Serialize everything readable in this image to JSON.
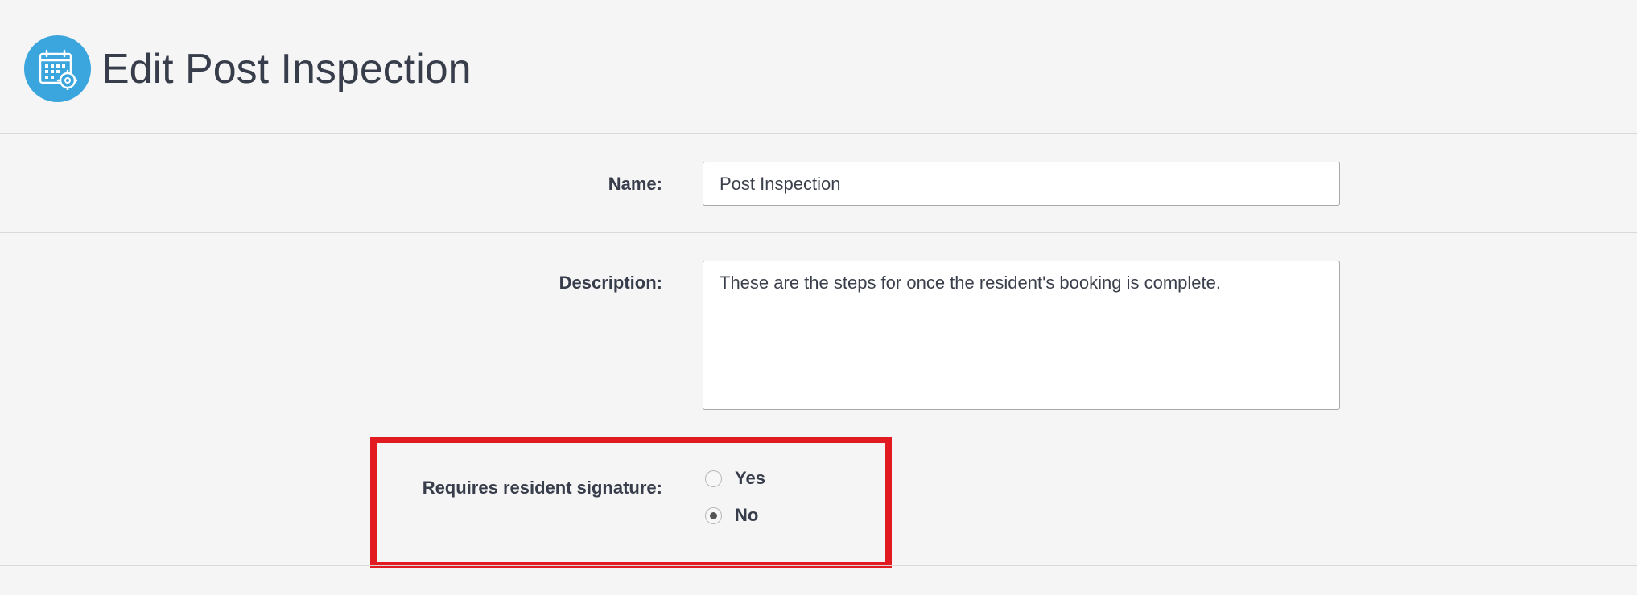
{
  "page": {
    "title": "Edit Post Inspection",
    "icon": "calendar-gear-icon",
    "accent_color": "#3aa6dd"
  },
  "form": {
    "name": {
      "label": "Name:",
      "value": "Post Inspection"
    },
    "description": {
      "label": "Description:",
      "value": "These are the steps for once the resident's booking is complete."
    },
    "signature": {
      "label": "Requires resident signature:",
      "options": [
        {
          "label": "Yes",
          "checked": false
        },
        {
          "label": "No",
          "checked": true
        }
      ]
    }
  },
  "highlight": {
    "color": "#e21a22"
  }
}
